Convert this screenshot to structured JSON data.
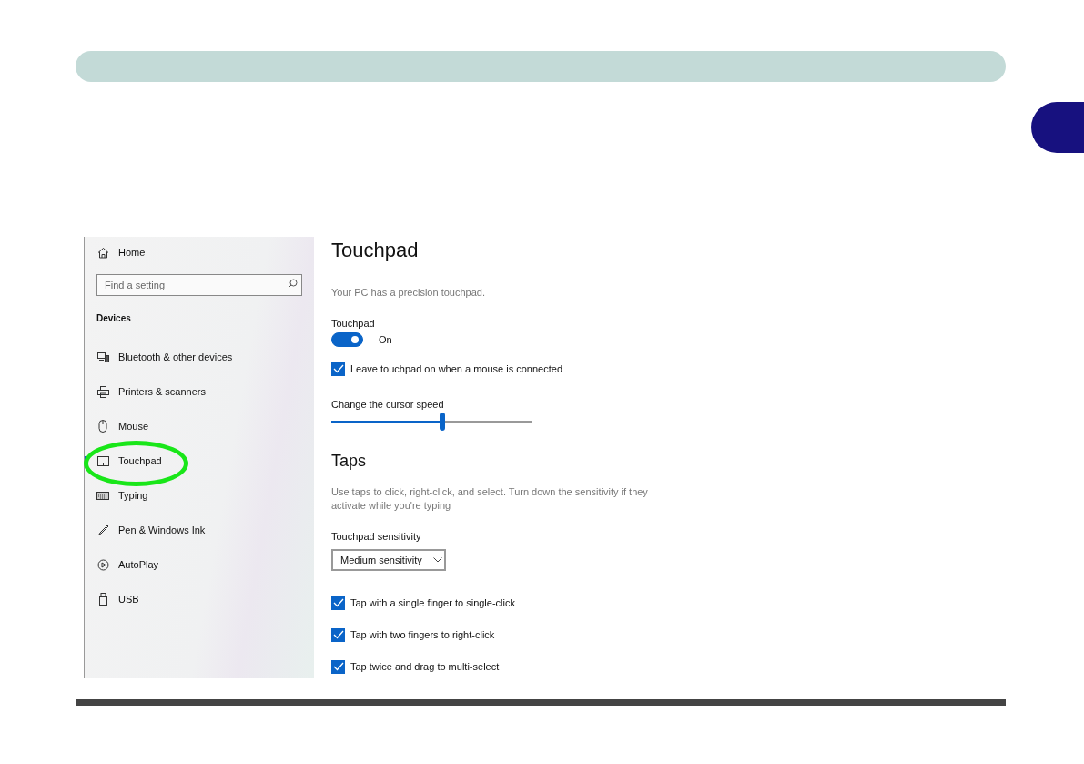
{
  "sidebar": {
    "home": "Home",
    "search": {
      "placeholder": "Find a setting"
    },
    "section": "Devices",
    "items": [
      {
        "label": "Bluetooth & other devices",
        "kind": "bluetooth",
        "selected": false,
        "highlighted": false
      },
      {
        "label": "Printers & scanners",
        "kind": "printer",
        "selected": false,
        "highlighted": false
      },
      {
        "label": "Mouse",
        "kind": "mouse",
        "selected": false,
        "highlighted": false
      },
      {
        "label": "Touchpad",
        "kind": "touchpad",
        "selected": true,
        "highlighted": true
      },
      {
        "label": "Typing",
        "kind": "keyboard",
        "selected": false,
        "highlighted": false
      },
      {
        "label": "Pen & Windows Ink",
        "kind": "pen",
        "selected": false,
        "highlighted": false
      },
      {
        "label": "AutoPlay",
        "kind": "autoplay",
        "selected": false,
        "highlighted": false
      },
      {
        "label": "USB",
        "kind": "usb",
        "selected": false,
        "highlighted": false
      }
    ]
  },
  "main": {
    "title": "Touchpad",
    "subtitle": "Your PC has a precision touchpad.",
    "toggle": {
      "label": "Touchpad",
      "on": true,
      "state_text": "On"
    },
    "leave_on": {
      "label": "Leave touchpad on when a mouse is connected",
      "checked": true
    },
    "speed": {
      "label": "Change the cursor speed",
      "level": 0.55
    },
    "taps": {
      "heading": "Taps",
      "description": "Use taps to click, right-click, and select. Turn down the sensitivity if they activate while you're typing",
      "sensitivity": {
        "label": "Touchpad sensitivity",
        "value": "Medium sensitivity"
      },
      "options": [
        {
          "label": "Tap with a single finger to single-click",
          "checked": true
        },
        {
          "label": "Tap with two fingers to right-click",
          "checked": true
        },
        {
          "label": "Tap twice and drag to multi-select",
          "checked": true
        }
      ]
    }
  }
}
